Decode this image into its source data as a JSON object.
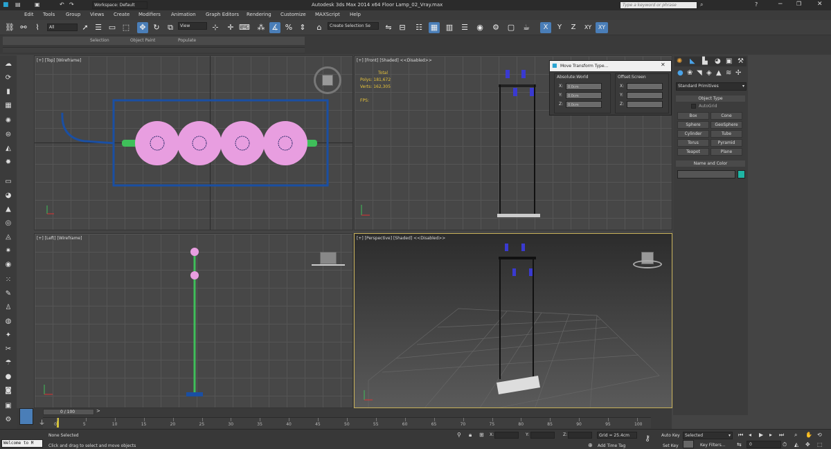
{
  "title_bar": {
    "workspace": "Workspace: Default",
    "title": "Autodesk 3ds Max  2014 x64     Floor Lamp_02_Vray.max",
    "search_placeholder": "Type a keyword or phrase"
  },
  "menu": [
    "Edit",
    "Tools",
    "Group",
    "Views",
    "Create",
    "Modifiers",
    "Animation",
    "Graph Editors",
    "Rendering",
    "Customize",
    "MAXScript",
    "Help"
  ],
  "toolbar": {
    "selection_filter": "All",
    "ref_coord": "View",
    "named_selection": "Create Selection Se",
    "axis_x": "X",
    "axis_y": "Y",
    "axis_z": "Z",
    "axis_xy": "XY",
    "axis_xy2": "XY"
  },
  "ribbon_tabs": [
    "Selection",
    "Object Paint",
    "Populate"
  ],
  "viewports": {
    "top": "[+] [Top] [Wireframe]",
    "front": "[+] [Front] [Shaded]  <<Disabled>>",
    "left": "[+] [Left] [Wireframe]",
    "perspective": "[+] [Perspective] [Shaded] <<Disabled>>"
  },
  "stats": {
    "total_label": "Total",
    "polys_label": "Polys:",
    "polys_value": "181,672",
    "verts_label": "Verts:",
    "verts_value": "162,305",
    "fps_label": "FPS:"
  },
  "dialog": {
    "title": "Move Transform Type...",
    "absolute_label": "Absolute:World",
    "offset_label": "Offset:Screen",
    "x": "X:",
    "y": "Y:",
    "z": "Z:",
    "ax": "0.0cm",
    "ay": "0.0cm",
    "az": "0.0cm"
  },
  "command_panel": {
    "category": "Standard Primitives",
    "object_type": "Object Type",
    "autogrid": "AutoGrid",
    "buttons": [
      "Box",
      "Cone",
      "Sphere",
      "GeoSphere",
      "Cylinder",
      "Tube",
      "Torus",
      "Pyramid",
      "Teapot",
      "Plane"
    ],
    "name_color": "Name and Color",
    "swatch_color": "#1fb5a4"
  },
  "timeline": {
    "frame": "0 / 100",
    "ticks": [
      "0",
      "5",
      "10",
      "15",
      "20",
      "25",
      "30",
      "35",
      "40",
      "45",
      "50",
      "55",
      "60",
      "65",
      "70",
      "75",
      "80",
      "85",
      "90",
      "95",
      "100"
    ]
  },
  "status": {
    "maxscript": "Welcome to M",
    "none_selected": "None Selected",
    "prompt": "Click and drag to select and move objects",
    "x_label": "X:",
    "y_label": "Y:",
    "z_label": "Z:",
    "grid": "Grid = 25.4cm",
    "add_time_tag": "Add Time Tag",
    "auto_key": "Auto Key",
    "selected": "Selected",
    "set_key": "Set Key",
    "key_filters": "Key Filters...",
    "frame_value": "0"
  },
  "colors": {
    "accent_blue": "#4a7eb8",
    "lamp_pink": "#e89ee0",
    "selection_blue": "#1a4fa3",
    "green": "#3fbf5a"
  }
}
